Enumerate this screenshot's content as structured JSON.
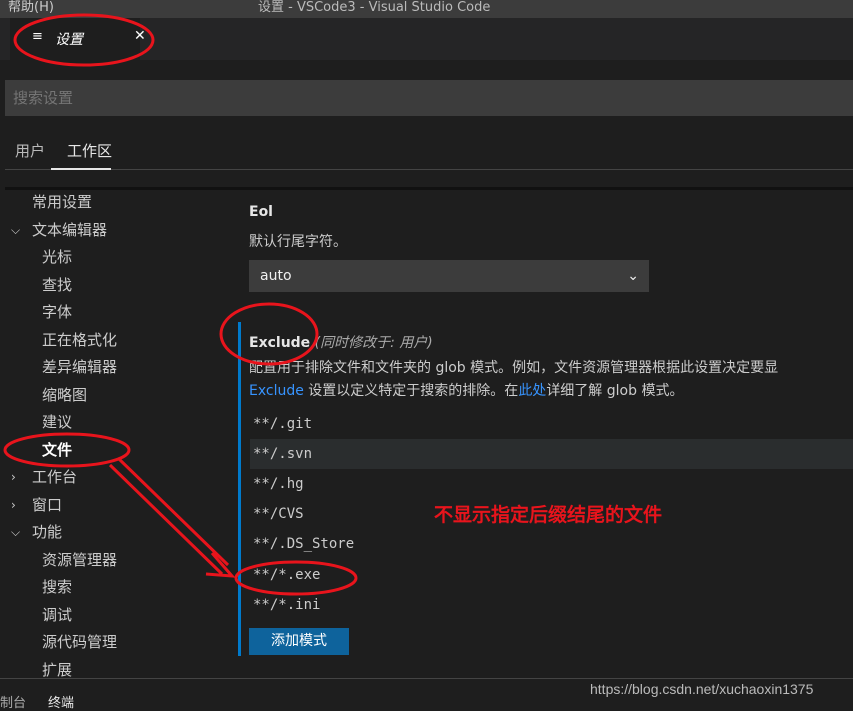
{
  "titlebar": {
    "menu": "帮助(H)",
    "title": "设置 - VSCode3 - Visual Studio Code"
  },
  "tab": {
    "icon": "settings-list-icon",
    "label": "设置",
    "close": "✕"
  },
  "search": {
    "placeholder": "搜索设置"
  },
  "scopes": [
    "用户",
    "工作区"
  ],
  "sidebar": [
    {
      "label": "常用设置",
      "level": 0,
      "chevron": ""
    },
    {
      "label": "文本编辑器",
      "level": 0,
      "chevron": "down"
    },
    {
      "label": "光标",
      "level": 1
    },
    {
      "label": "查找",
      "level": 1
    },
    {
      "label": "字体",
      "level": 1
    },
    {
      "label": "正在格式化",
      "level": 1
    },
    {
      "label": "差异编辑器",
      "level": 1
    },
    {
      "label": "缩略图",
      "level": 1
    },
    {
      "label": "建议",
      "level": 1
    },
    {
      "label": "文件",
      "level": 1,
      "selected": true
    },
    {
      "label": "工作台",
      "level": 0,
      "chevron": "right"
    },
    {
      "label": "窗口",
      "level": 0,
      "chevron": "right"
    },
    {
      "label": "功能",
      "level": 0,
      "chevron": "down"
    },
    {
      "label": "资源管理器",
      "level": 1
    },
    {
      "label": "搜索",
      "level": 1
    },
    {
      "label": "调试",
      "level": 1
    },
    {
      "label": "源代码管理",
      "level": 1
    },
    {
      "label": "扩展",
      "level": 1
    }
  ],
  "eol": {
    "title": "Eol",
    "desc": "默认行尾字符。",
    "value": "auto"
  },
  "exclude": {
    "title": "Exclude",
    "modified": "(同时修改于: 用户)",
    "desc1": "配置用于排除文件和文件夹的 glob 模式。例如，文件资源管理器根据此设置决定要显",
    "link1": "Exclude",
    "desc2a": " 设置以定义特定于搜索的排除。在",
    "link2": "此处",
    "desc2b": "详细了解 glob 模式。",
    "patterns": [
      "**/.git",
      "**/.svn",
      "**/.hg",
      "**/CVS",
      "**/.DS_Store",
      "**/*.exe",
      "**/*.ini"
    ],
    "add_button": "添加模式"
  },
  "annotation": "不显示指定后缀结尾的文件",
  "panel": {
    "tabs": [
      "制台",
      "终端"
    ]
  },
  "watermark": "https://blog.csdn.net/xuchaoxin1375",
  "colors": {
    "accent": "#0e639c",
    "annotation": "#e8141c",
    "link": "#3794ff"
  }
}
